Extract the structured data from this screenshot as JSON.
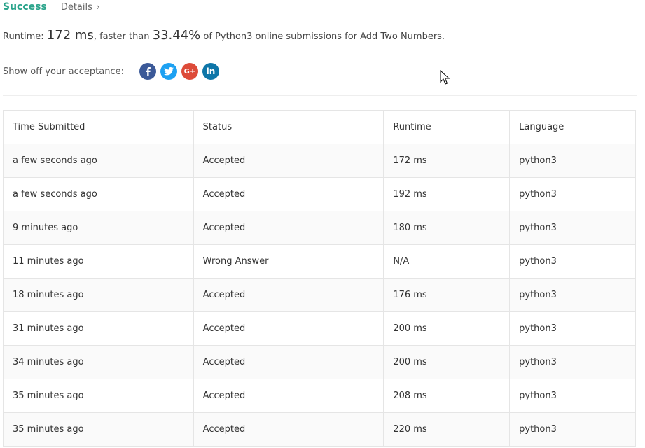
{
  "header": {
    "success_label": "Success",
    "details_label": "Details",
    "details_chevron": "›"
  },
  "runtime": {
    "prefix": "Runtime: ",
    "value": "172 ms",
    "middle": ", faster than ",
    "percent": "33.44%",
    "suffix": " of Python3 online submissions for Add Two Numbers."
  },
  "share": {
    "label": "Show off your acceptance:",
    "buttons": [
      {
        "icon": "facebook-icon",
        "color": "#3b5998"
      },
      {
        "icon": "twitter-icon",
        "color": "#1da1f2"
      },
      {
        "icon": "google-plus-icon",
        "color": "#dd4b39",
        "glyph": "G+"
      },
      {
        "icon": "linkedin-icon",
        "color": "#0e76a8",
        "glyph": "in"
      }
    ]
  },
  "table": {
    "headers": [
      "Time Submitted",
      "Status",
      "Runtime",
      "Language"
    ],
    "rows": [
      [
        "a few seconds ago",
        "Accepted",
        "172 ms",
        "python3"
      ],
      [
        "a few seconds ago",
        "Accepted",
        "192 ms",
        "python3"
      ],
      [
        "9 minutes ago",
        "Accepted",
        "180 ms",
        "python3"
      ],
      [
        "11 minutes ago",
        "Wrong Answer",
        "N/A",
        "python3"
      ],
      [
        "18 minutes ago",
        "Accepted",
        "176 ms",
        "python3"
      ],
      [
        "31 minutes ago",
        "Accepted",
        "200 ms",
        "python3"
      ],
      [
        "34 minutes ago",
        "Accepted",
        "200 ms",
        "python3"
      ],
      [
        "35 minutes ago",
        "Accepted",
        "208 ms",
        "python3"
      ],
      [
        "35 minutes ago",
        "Accepted",
        "220 ms",
        "python3"
      ]
    ]
  },
  "colors": {
    "accepted": "#2aa48b",
    "wrong": "#d9534f"
  }
}
